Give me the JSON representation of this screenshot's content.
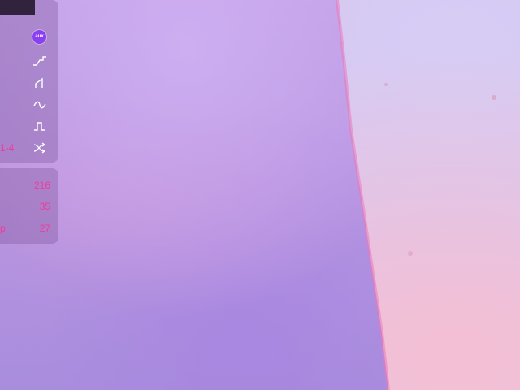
{
  "toolbar": {
    "badge_text": "aux",
    "icons": [
      "ramp-step-icon",
      "sawtooth-icon",
      "sine-wave-icon",
      "square-wave-icon",
      "shuffle-icon"
    ],
    "range_label": "1-4"
  },
  "stats": {
    "rows": [
      {
        "label": "",
        "value": "216"
      },
      {
        "label": "",
        "value": "35"
      },
      {
        "label": "p",
        "value": "27"
      }
    ]
  },
  "colors": {
    "accent_pink": "#f23b9a",
    "badge_purple": "#8a3ff0",
    "panel": "#805aa0"
  }
}
